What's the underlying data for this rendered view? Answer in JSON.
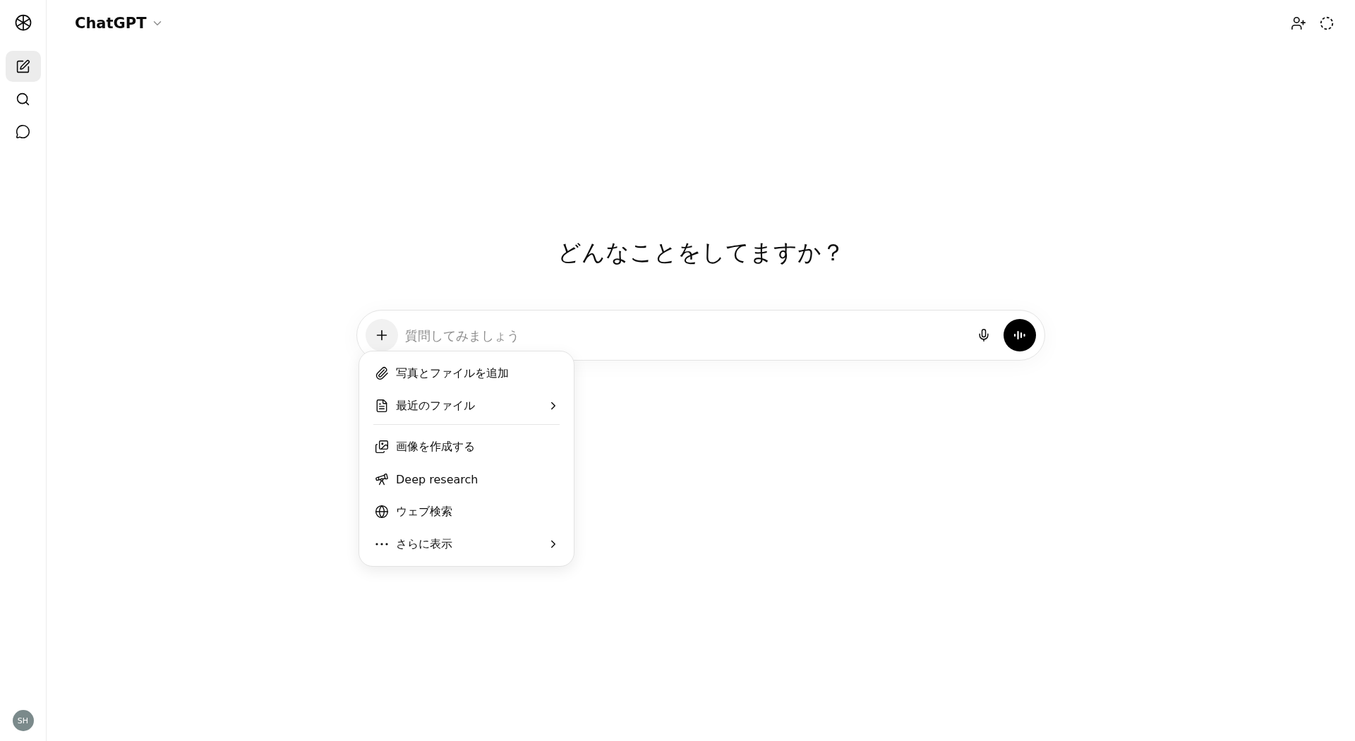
{
  "header": {
    "title": "ChatGPT"
  },
  "sidebar": {
    "items": [
      {
        "kind": "new-chat",
        "selected": true
      },
      {
        "kind": "search",
        "selected": false
      },
      {
        "kind": "chats",
        "selected": false
      }
    ],
    "avatar": "SH"
  },
  "heading": "どんなことをしてますか？",
  "composer": {
    "placeholder": "質問してみましょう"
  },
  "menu": {
    "items": [
      {
        "kind": "attach",
        "label": "写真とファイルを追加",
        "submenu": false
      },
      {
        "kind": "file",
        "label": "最近のファイル",
        "submenu": true
      },
      {
        "kind": "separator"
      },
      {
        "kind": "image",
        "label": "画像を作成する",
        "submenu": false
      },
      {
        "kind": "telescope",
        "label": "Deep research",
        "submenu": false
      },
      {
        "kind": "globe",
        "label": "ウェブ検索",
        "submenu": false
      },
      {
        "kind": "more",
        "label": "さらに表示",
        "submenu": true
      }
    ]
  }
}
